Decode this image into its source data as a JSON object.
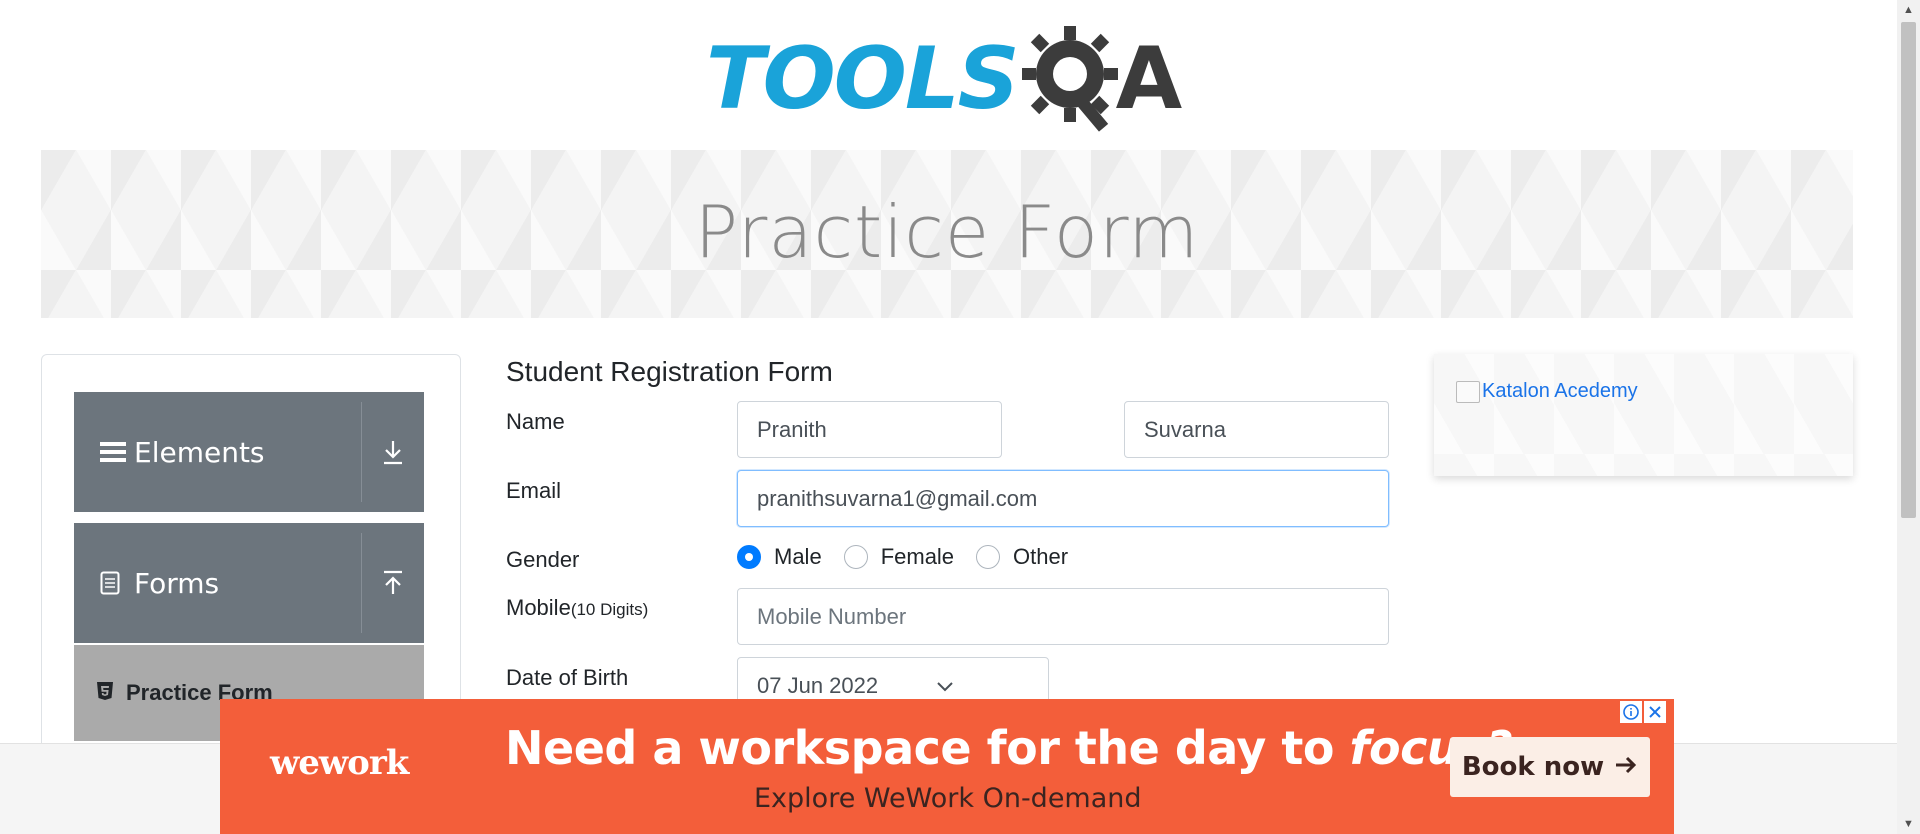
{
  "logo": {
    "tools": "TOOLS",
    "a": "A"
  },
  "banner": {
    "title": "Practice Form"
  },
  "sidebar": {
    "groups": [
      {
        "label": "Elements",
        "icon": "hamburger-icon",
        "arrow": "download-arrow-icon"
      },
      {
        "label": "Forms",
        "icon": "document-icon",
        "arrow": "upload-arrow-icon"
      }
    ],
    "active_item": {
      "label": "Practice Form",
      "icon": "html5-icon"
    }
  },
  "form": {
    "title": "Student Registration Form",
    "name_label": "Name",
    "first_name": "Pranith",
    "last_name": "Suvarna",
    "email_label": "Email",
    "email": "pranithsuvarna1@gmail.com",
    "gender_label": "Gender",
    "gender_options": [
      "Male",
      "Female",
      "Other"
    ],
    "gender_selected": "Male",
    "mobile_label": "Mobile",
    "mobile_hint": "(10 Digits)",
    "mobile_placeholder": "Mobile Number",
    "dob_label": "Date of Birth",
    "dob": "07 Jun 2022"
  },
  "side_ad": {
    "alt_text": "Katalon Acedemy"
  },
  "bottom_ad": {
    "brand": "wework",
    "headline_main": "Need a workspace for the day to ",
    "headline_em": "focus?",
    "sub": "Explore WeWork On-demand",
    "cta": "Book now",
    "info_icon": "info-icon",
    "close_icon": "close-icon"
  },
  "colors": {
    "logo_blue": "#1aa3d9",
    "sidebar_group": "#6c757d",
    "sidebar_active": "#aaaaaa",
    "radio_checked": "#007bff",
    "ad_orange": "#f35e3a"
  }
}
